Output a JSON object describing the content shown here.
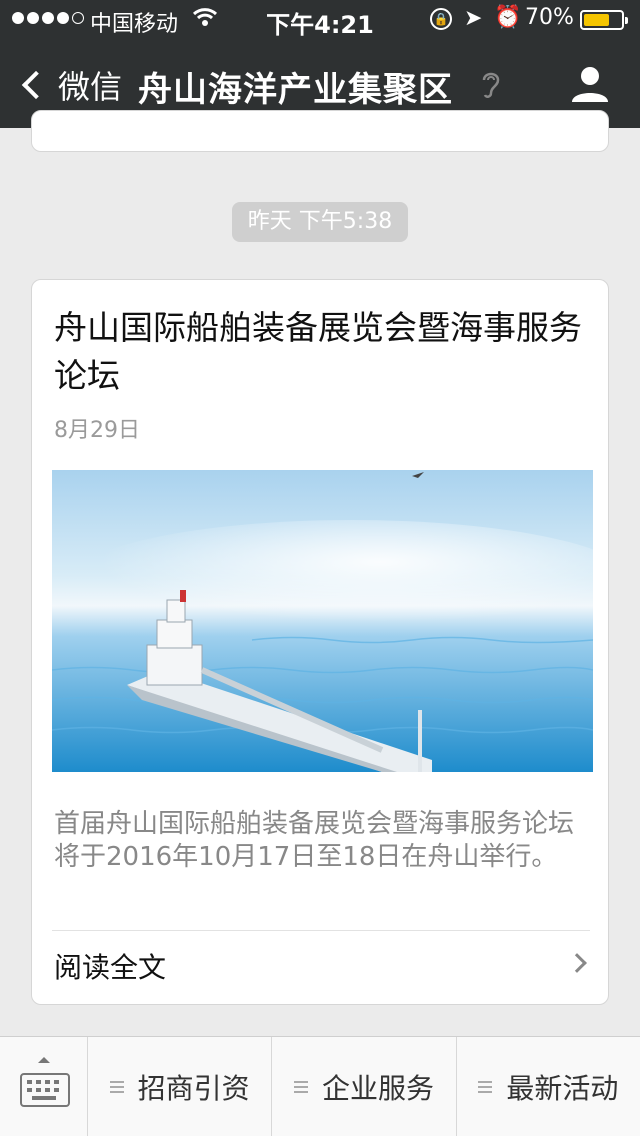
{
  "status": {
    "carrier": "中国移动",
    "time": "下午4:21",
    "battery": "70%"
  },
  "nav": {
    "back_label": "微信",
    "title": "舟山海洋产业集聚区"
  },
  "timestamp": "昨天 下午5:38",
  "article": {
    "title": "舟山国际船舶装备展览会暨海事服务论坛",
    "date": "8月29日",
    "description": "首届舟山国际船舶装备展览会暨海事服务论坛将于2016年10月17日至18日在舟山举行。",
    "read_more": "阅读全文"
  },
  "menu": {
    "items": [
      {
        "label": "招商引资"
      },
      {
        "label": "企业服务"
      },
      {
        "label": "最新活动"
      }
    ]
  },
  "colors": {
    "nav_bg": "#2e3132",
    "battery": "#f5c500",
    "page_bg": "#ebebeb"
  }
}
